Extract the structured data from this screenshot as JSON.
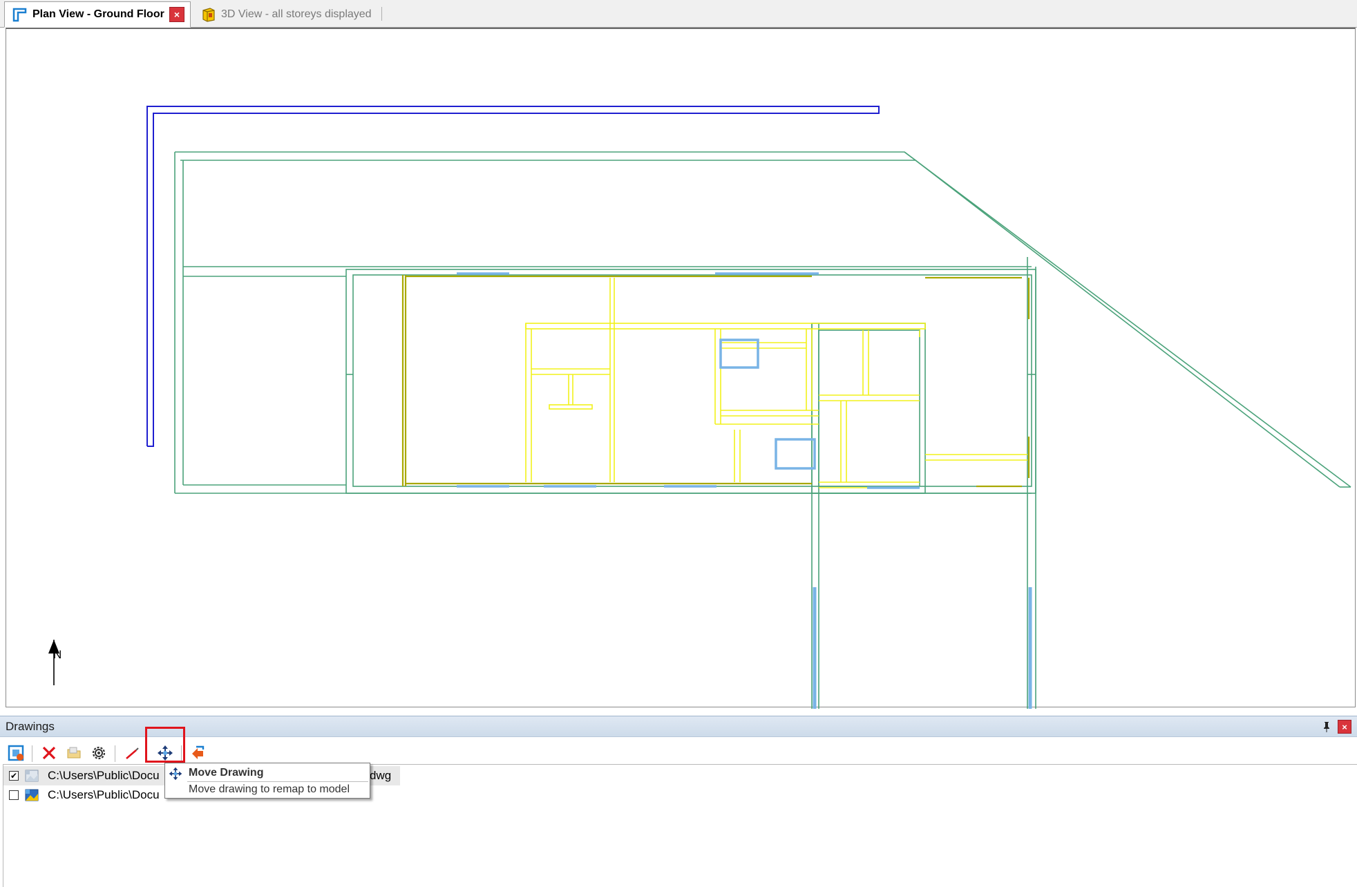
{
  "tabs": [
    {
      "label": "Plan View - Ground Floor",
      "active": true,
      "icon": "plan-view-icon"
    },
    {
      "label": "3D View - all storeys displayed",
      "active": false,
      "icon": "3d-view-icon"
    }
  ],
  "tab_close_glyph": "×",
  "canvas": {
    "north_label": "N"
  },
  "panel": {
    "title": "Drawings",
    "close_glyph": "×",
    "toolbar": [
      {
        "name": "add-drawing-button",
        "icon": "add-drawing-icon",
        "tooltip": ""
      },
      {
        "name": "delete-drawing-button",
        "icon": "delete-icon",
        "tooltip": ""
      },
      {
        "name": "open-folder-button",
        "icon": "folder-icon",
        "tooltip": ""
      },
      {
        "name": "drawing-settings-button",
        "icon": "gear-icon",
        "tooltip": ""
      },
      {
        "name": "draw-line-button",
        "icon": "pen-icon",
        "tooltip": ""
      },
      {
        "name": "move-drawing-button",
        "icon": "move-arrows-icon",
        "tooltip": "Move Drawing"
      },
      {
        "name": "remap-drawing-button",
        "icon": "remap-icon",
        "tooltip": ""
      }
    ],
    "rows": [
      {
        "path": "C:\\Users\\Public\\Docu",
        "tail": "dwg",
        "checked": true,
        "selected": true
      },
      {
        "path": "C:\\Users\\Public\\Docu",
        "tail": "",
        "checked": false,
        "selected": false
      }
    ]
  },
  "tooltip": {
    "title": "Move Drawing",
    "description": "Move drawing to remap to model"
  },
  "colors": {
    "outer_wall": "#4aa27a",
    "inner_wall": "#f2f21a",
    "window": "#79b4e6",
    "boundary": "#1e1ed0",
    "dark_wall": "#a8a800",
    "highlight": "#e0141c"
  }
}
